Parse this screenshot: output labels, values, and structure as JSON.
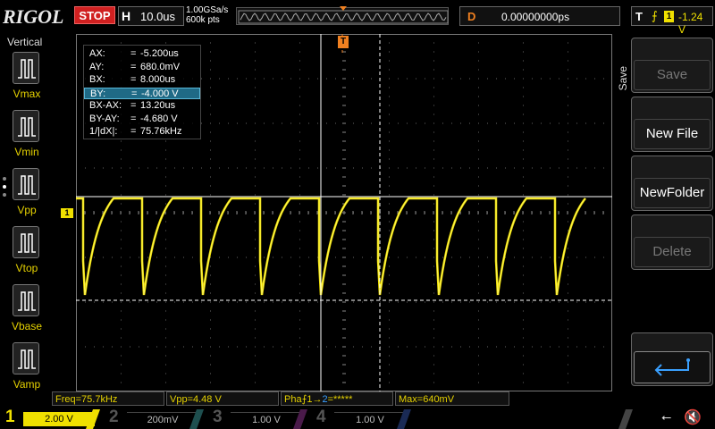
{
  "topbar": {
    "logo": "RIGOL",
    "run_state": "STOP",
    "timebase_label": "H",
    "timebase_value": "10.0us",
    "sample_rate": "1.00GSa/s",
    "memory_depth": "600k pts",
    "delay_label": "D",
    "delay_value": "0.00000000ps",
    "trigger_label": "T",
    "trigger_source": "1",
    "trigger_level": "-1.24 V"
  },
  "left_panel": {
    "title": "Vertical",
    "items": [
      {
        "label": "Vmax",
        "icon": "vmax-icon"
      },
      {
        "label": "Vmin",
        "icon": "vmin-icon"
      },
      {
        "label": "Vpp",
        "icon": "vpp-icon"
      },
      {
        "label": "Vtop",
        "icon": "vtop-icon"
      },
      {
        "label": "Vbase",
        "icon": "vbase-icon"
      },
      {
        "label": "Vamp",
        "icon": "vamp-icon"
      }
    ]
  },
  "cursor_readout": {
    "rows": [
      {
        "key": "AX:",
        "eq": "=",
        "value": "-5.200us"
      },
      {
        "key": "AY:",
        "eq": "=",
        "value": "680.0mV"
      },
      {
        "key": "BX:",
        "eq": "=",
        "value": "8.000us"
      },
      {
        "key": "BY:",
        "eq": "=",
        "value": "-4.000 V"
      },
      {
        "key": "BX-AX:",
        "eq": "=",
        "value": "13.20us"
      },
      {
        "key": "BY-AY:",
        "eq": "=",
        "value": "-4.680 V"
      },
      {
        "key": "1/|dX|:",
        "eq": "=",
        "value": "75.76kHz"
      }
    ],
    "selected_index": 3
  },
  "markers": {
    "ch1": "1",
    "trigger": "T"
  },
  "right_panel": {
    "title": "Save",
    "buttons": [
      {
        "label": "Save",
        "enabled": false
      },
      {
        "label": "New File",
        "enabled": true
      },
      {
        "label": "NewFolder",
        "enabled": true
      },
      {
        "label": "Delete",
        "enabled": false
      }
    ],
    "back_icon": "return-arrow-icon"
  },
  "measurements": {
    "freq": "Freq=75.7kHz",
    "vpp": "Vpp=4.48 V",
    "phase_prefix": "Pha",
    "phase_a": "1",
    "phase_arrow": "→",
    "phase_b": "2",
    "phase_suffix": "=*****",
    "max": "Max=640mV"
  },
  "channels": [
    {
      "num": "1",
      "scale": "2.00 V"
    },
    {
      "num": "2",
      "scale": "200mV"
    },
    {
      "num": "3",
      "scale": "1.00 V"
    },
    {
      "num": "4",
      "scale": "1.00 V"
    }
  ],
  "status_icons": [
    "usb-icon",
    "speaker-mute-icon"
  ],
  "colors": {
    "ch1": "#f0e000",
    "trigger": "#f08020",
    "stop": "#d02020",
    "highlight": "#1f6a86"
  }
}
